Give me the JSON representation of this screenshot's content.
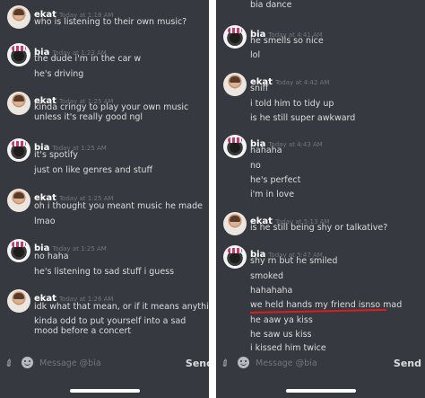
{
  "left": {
    "messages": [
      {
        "author": "ekat",
        "time": "Today at 1:18 AM",
        "lines": [
          "who is listening to their own music?"
        ]
      },
      {
        "author": "bia",
        "time": "Today at 1:23 AM",
        "lines": [
          "the dude i'm in the car w",
          "he's driving"
        ]
      },
      {
        "author": "ekat",
        "time": "Today at 1:25 AM",
        "lines": [
          "kinda cringy to play your own music unless it's really good ngl"
        ]
      },
      {
        "author": "bia",
        "time": "Today at 1:25 AM",
        "lines": [
          "it's spotify",
          "just on like genres and stuff"
        ]
      },
      {
        "author": "ekat",
        "time": "Today at 1:25 AM",
        "lines": [
          "oh i thought you meant music he made",
          "lmao"
        ]
      },
      {
        "author": "bia",
        "time": "Today at 1:25 AM",
        "lines": [
          "no haha",
          "he's listening to sad stuff i guess"
        ]
      },
      {
        "author": "ekat",
        "time": "Today at 1:26 AM",
        "lines": [
          "idk what that mean, or if it means anything",
          "kinda odd to put yourself into a sad mood before a concert"
        ]
      }
    ],
    "placeholder": "Message @bia",
    "send": "Send"
  },
  "right": {
    "top_line": "bia dance",
    "messages": [
      {
        "author": "bia",
        "time": "Today at 4:41 AM",
        "lines": [
          "he smells so nice",
          "lol"
        ]
      },
      {
        "author": "ekat",
        "time": "Today at 4:42 AM",
        "lines": [
          "sniff",
          "i told him to tidy up",
          "is he still super awkward"
        ]
      },
      {
        "author": "bia",
        "time": "Today at 4:43 AM",
        "lines": [
          "hahaha",
          "no",
          "he's perfect",
          "i'm in love"
        ]
      },
      {
        "author": "ekat",
        "time": "Today at 5:13 AM",
        "lines": [
          "is he still being shy or talkative?"
        ]
      },
      {
        "author": "bia",
        "time": "Today at 5:47 AM",
        "lines": [
          "shy rn but he smiled",
          "smoked",
          "hahahaha",
          "we held hands my friend isnso mad",
          "he aaw ya kiss",
          "he saw us kiss",
          "i kissed him twice"
        ]
      }
    ],
    "placeholder": "Message @bia",
    "send": "Send"
  }
}
